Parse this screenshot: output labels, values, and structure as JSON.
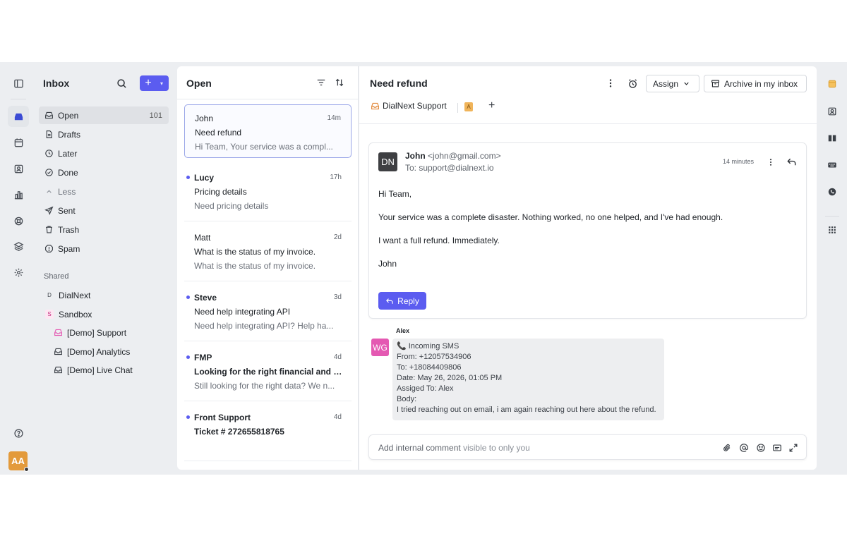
{
  "nav": {
    "title": "Inbox",
    "items": [
      {
        "label": "Open",
        "count": "101"
      },
      {
        "label": "Drafts"
      },
      {
        "label": "Later"
      },
      {
        "label": "Done"
      },
      {
        "label": "Less"
      },
      {
        "label": "Sent"
      },
      {
        "label": "Trash"
      },
      {
        "label": "Spam"
      }
    ],
    "shared_title": "Shared",
    "shared": [
      {
        "badge": "D",
        "label": "DialNext"
      },
      {
        "badge": "S",
        "label": "Sandbox"
      }
    ],
    "sub": [
      {
        "label": "[Demo] Support"
      },
      {
        "label": "[Demo] Analytics"
      },
      {
        "label": "[Demo] Live Chat"
      }
    ],
    "user_initials": "AA"
  },
  "list": {
    "title": "Open",
    "conversations": [
      {
        "from": "John",
        "time": "14m",
        "subject": "Need refund",
        "snippet": "Hi Team, Your service was a compl..."
      },
      {
        "from": "Lucy",
        "time": "17h",
        "subject": "Pricing details",
        "snippet": "Need pricing details"
      },
      {
        "from": "Matt",
        "time": "2d",
        "subject": "What is the status of my invoice.",
        "snippet": "What is the status of my invoice."
      },
      {
        "from": "Steve",
        "time": "3d",
        "subject": "Need help integrating API",
        "snippet": "Need help integrating API? Help ha..."
      },
      {
        "from": "FMP",
        "time": "4d",
        "subject": "Looking for the right financial and s...",
        "snippet": "Still looking for the right data? We n..."
      },
      {
        "from": "Front Support",
        "time": "4d",
        "subject": "Ticket # 272655818765",
        "snippet": ""
      }
    ]
  },
  "detail": {
    "title": "Need refund",
    "assign_label": "Assign",
    "archive_label": "Archive in my inbox",
    "inbox_name": "DialNext Support",
    "tag": "A",
    "message": {
      "avatar": "DN",
      "from_name": "John",
      "from_email": "<john@gmail.com>",
      "to": "To: support@dialnext.io",
      "time": "14 minutes",
      "lines": [
        "Hi Team,",
        "Your service was a complete disaster. Nothing worked, no one helped, and I've had enough.",
        "I want a full refund. Immediately.",
        "John"
      ],
      "reply_label": "Reply"
    },
    "note": {
      "author": "Alex",
      "avatar": "WG",
      "lines": [
        "📞 Incoming SMS",
        "From: +12057534906",
        "To: +18084409806",
        "Date: May 26, 2026, 01:05 PM",
        "Assiged To: Alex",
        "Body:",
        "I tried reaching out on email, i am again reaching out here about the refund."
      ]
    },
    "comment": {
      "placeholder": "Add internal comment",
      "hint": "visible to only you"
    }
  },
  "colors": {
    "accent": "#5b5cf0",
    "brand_orange": "#e39a3b",
    "note_avatar": "#e459b2"
  }
}
